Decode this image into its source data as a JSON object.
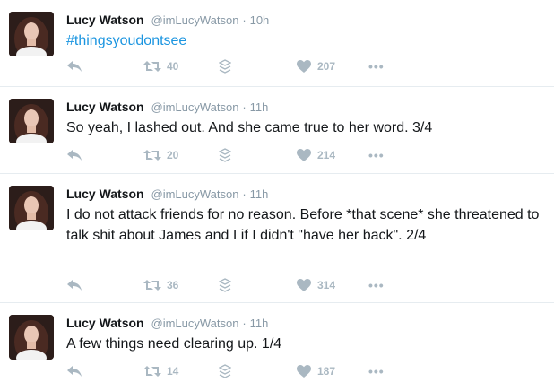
{
  "tweets": [
    {
      "name": "Lucy Watson",
      "handle": "@imLucyWatson",
      "sep": "·",
      "time": "10h",
      "text": "#thingsyoudontsee",
      "retweets": "40",
      "likes": "207"
    },
    {
      "name": "Lucy Watson",
      "handle": "@imLucyWatson",
      "sep": "·",
      "time": "11h",
      "text": "So yeah, I lashed out. And she came true to her word. 3/4",
      "retweets": "20",
      "likes": "214"
    },
    {
      "name": "Lucy Watson",
      "handle": "@imLucyWatson",
      "sep": "·",
      "time": "11h",
      "text": "I do not attack friends for no reason. Before *that scene* she threatened to talk shit about James and I if I didn't \"have her back\". 2/4",
      "retweets": "36",
      "likes": "314"
    },
    {
      "name": "Lucy Watson",
      "handle": "@imLucyWatson",
      "sep": "·",
      "time": "11h",
      "text": "A few things need clearing up. 1/4",
      "retweets": "14",
      "likes": "187"
    }
  ],
  "icons": {
    "reply": "reply-icon",
    "retweet": "retweet-icon",
    "stack": "stack-icon",
    "like": "heart-icon",
    "more": "more-icon"
  },
  "more_label": "•••",
  "colors": {
    "name": "#14171a",
    "meta": "#8899a6",
    "hashtag": "#1b95e0",
    "action": "#aab8c2",
    "divider": "#e6ecf0"
  }
}
